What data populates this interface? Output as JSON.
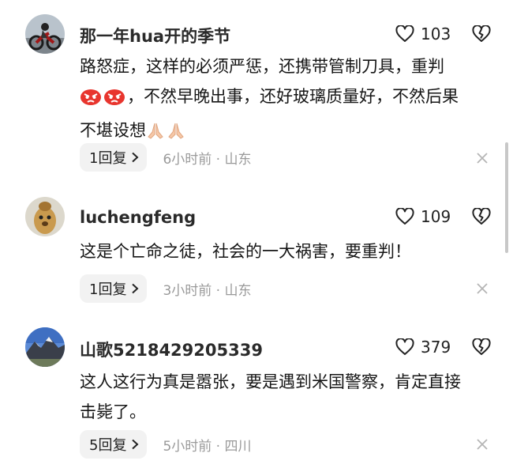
{
  "comments": [
    {
      "username": "那一年hua开的季节",
      "avatar": "motorcycle-rider-photo",
      "likes": "103",
      "text_line1": "路怒症，这样的必须严惩，还携带管制刀具，重判",
      "text_line2": "，不然早晚出事，还好玻璃质量好，不然后果",
      "text_line3": "不堪设想",
      "emojis": [
        "angry-face",
        "angry-face",
        "praying-hands",
        "praying-hands"
      ],
      "reply_label": "1回复",
      "time_location": "6小时前 · 山东"
    },
    {
      "username": "luchengfeng",
      "avatar": "cartoon-dog-photo",
      "likes": "109",
      "text_line1": "这是个亡命之徒，社会的一大祸害，要重判！",
      "reply_label": "1回复",
      "time_location": "3小时前 · 山东"
    },
    {
      "username": "山歌5218429205339",
      "avatar": "mountain-landscape-photo",
      "likes": "379",
      "text_line1": "这人这行为真是嚣张，要是遇到米国警察，肯定直接",
      "text_line2": "击毙了。",
      "reply_label": "5回复",
      "time_location": "5小时前 · 四川"
    }
  ],
  "icons": {
    "like": "heart-outline-icon",
    "dislike": "broken-heart-outline-icon",
    "reply_arrow": "chevron-right-icon",
    "dismiss": "close-icon"
  },
  "colors": {
    "text": "#161616",
    "meta": "#9a9a9a",
    "reply_bg": "#f2f2f2"
  }
}
